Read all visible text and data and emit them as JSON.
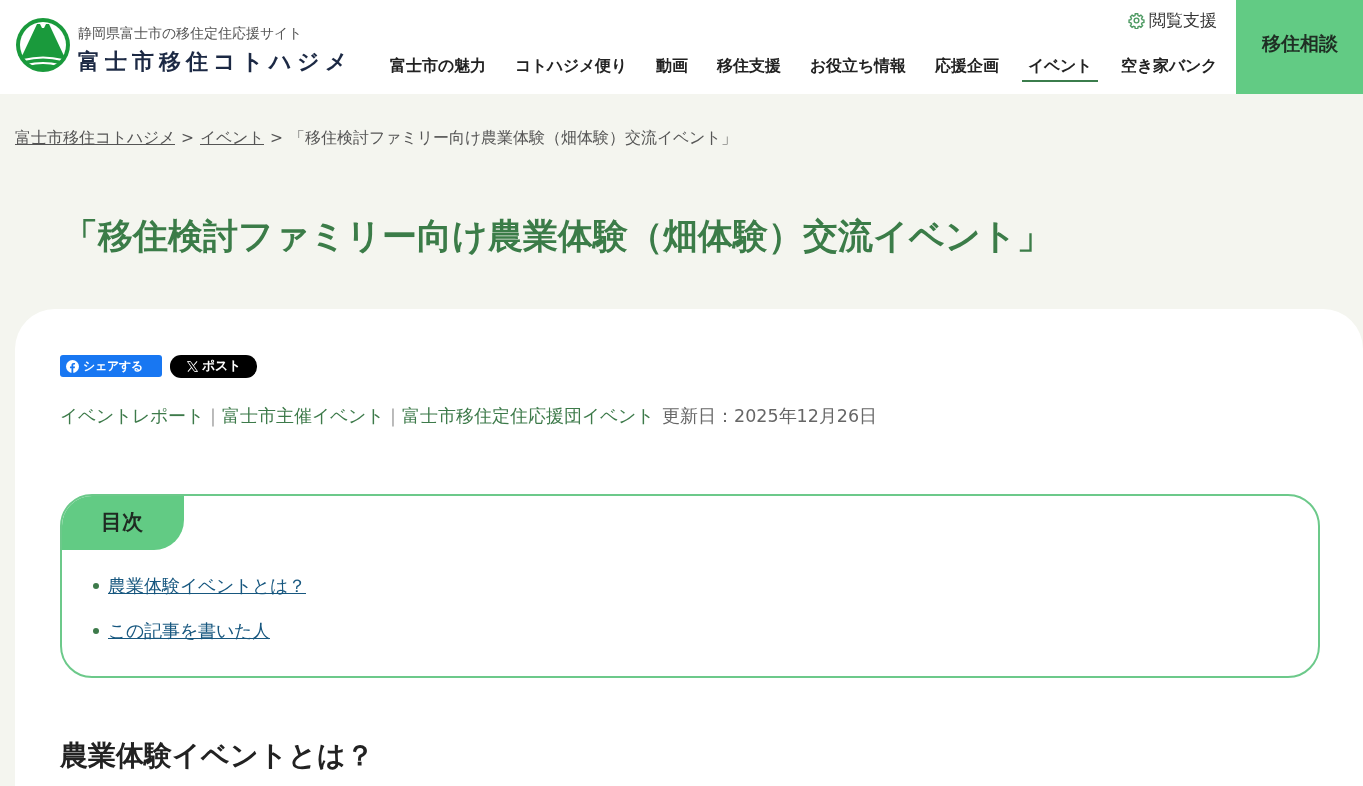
{
  "header": {
    "tagline": "静岡県富士市の移住定住応援サイト",
    "logo_text": "富士市移住コトハジメ",
    "accessibility_link": "閲覧支援",
    "nav": [
      {
        "label": "富士市の魅力",
        "selected": false
      },
      {
        "label": "コトハジメ便り",
        "selected": false
      },
      {
        "label": "動画",
        "selected": false
      },
      {
        "label": "移住支援",
        "selected": false
      },
      {
        "label": "お役立ち情報",
        "selected": false
      },
      {
        "label": "応援企画",
        "selected": false
      },
      {
        "label": "イベント",
        "selected": true
      },
      {
        "label": "空き家バンク",
        "selected": false
      }
    ],
    "consult_button": "移住相談"
  },
  "breadcrumb": [
    {
      "kind": "link",
      "label": "富士市移住コトハジメ"
    },
    {
      "kind": "separator",
      "label": ">"
    },
    {
      "kind": "link",
      "label": "イベント"
    },
    {
      "kind": "separator",
      "label": ">"
    },
    {
      "kind": "current",
      "label": "「移住検討ファミリー向け農業体験（畑体験）交流イベント」"
    }
  ],
  "page_title": "「移住検討ファミリー向け農業体験（畑体験）交流イベント」",
  "article": {
    "share_buttons": [
      {
        "kind": "facebook",
        "label": "シェアする"
      },
      {
        "kind": "x",
        "label": "ポスト"
      }
    ],
    "categories": [
      {
        "kind": "link",
        "label": "イベントレポート"
      },
      {
        "kind": "separator",
        "label": "｜"
      },
      {
        "kind": "link",
        "label": "富士市主催イベント"
      },
      {
        "kind": "separator",
        "label": "｜"
      },
      {
        "kind": "link",
        "label": "富士市移住定住応援団イベント"
      }
    ],
    "updated": "更新日：2025年12月26日",
    "toc": {
      "title": "目次",
      "items": [
        "農業体験イベントとは？",
        "この記事を書いた人"
      ]
    },
    "section_heading": "農業体験イベントとは？"
  }
}
